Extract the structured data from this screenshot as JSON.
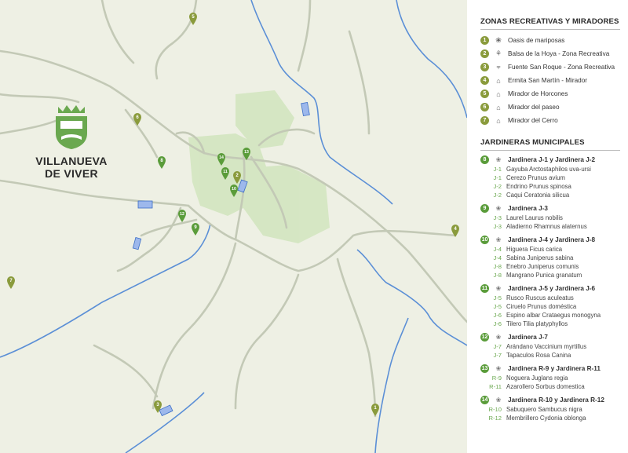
{
  "town": {
    "line1": "VILLANUEVA",
    "line2": "DE VIVER"
  },
  "colors": {
    "pin_olive": "#8a9b3c",
    "pin_green": "#5a9c3a",
    "road": "#bfc6b3",
    "river": "#5b8fd6",
    "park": "#cfe5b8",
    "feature_blue": "#9db8ec"
  },
  "legend": {
    "zones_title": "ZONAS RECREATIVAS Y MIRADORES",
    "zones": [
      {
        "num": "1",
        "icon": "butterfly-icon",
        "glyph": "❀",
        "label": "Oasis de mariposas"
      },
      {
        "num": "2",
        "icon": "tree-icon",
        "glyph": "⚘",
        "label": "Balsa de la Hoya - Zona Recreativa"
      },
      {
        "num": "3",
        "icon": "fountain-icon",
        "glyph": "⫧",
        "label": "Fuente San Roque - Zona Recreativa"
      },
      {
        "num": "4",
        "icon": "chapel-icon",
        "glyph": "⌂",
        "label": "Ermita San Martín - Mirador"
      },
      {
        "num": "5",
        "icon": "viewpoint-icon",
        "glyph": "⌂",
        "label": "Mirador de Horcones"
      },
      {
        "num": "6",
        "icon": "viewpoint-icon",
        "glyph": "⌂",
        "label": "Mirador del paseo"
      },
      {
        "num": "7",
        "icon": "viewpoint-icon",
        "glyph": "⌂",
        "label": "Mirador del Cerro"
      }
    ],
    "jard_title": "JARDINERAS MUNICIPALES",
    "jardineras": [
      {
        "num": "8",
        "title": "Jardinera J-1 y Jardinera J-2",
        "plants": [
          {
            "code": "J-1",
            "name": "Gayuba Arctostaphilos uva-ursi"
          },
          {
            "code": "J-1",
            "name": "Cerezo Prunus avium"
          },
          {
            "code": "J-2",
            "name": "Endrino Prunus spinosa"
          },
          {
            "code": "J-2",
            "name": "Caqui Ceratonia silicua"
          }
        ]
      },
      {
        "num": "9",
        "title": "Jardinera J-3",
        "plants": [
          {
            "code": "J-3",
            "name": "Laurel Laurus nobilis"
          },
          {
            "code": "J-3",
            "name": "Aladierno Rhamnus alaternus"
          }
        ]
      },
      {
        "num": "10",
        "title": "Jardinera J-4 y Jardinera J-8",
        "plants": [
          {
            "code": "J-4",
            "name": "Higuera Ficus carica"
          },
          {
            "code": "J-4",
            "name": "Sabina Juniperus sabina"
          },
          {
            "code": "J-8",
            "name": "Enebro Juniperus comunis"
          },
          {
            "code": "J-8",
            "name": "Mangrano Punica granatum"
          }
        ]
      },
      {
        "num": "11",
        "title": "Jardinera J-5 y Jardinera J-6",
        "plants": [
          {
            "code": "J-5",
            "name": "Rusco Ruscus aculeatus"
          },
          {
            "code": "J-5",
            "name": "Ciruelo Prunus doméstica"
          },
          {
            "code": "J-6",
            "name": "Espino albar Crataegus monogyna"
          },
          {
            "code": "J-6",
            "name": "Tilero Tilia platyphyllos"
          }
        ]
      },
      {
        "num": "12",
        "title": "Jardinera J-7",
        "plants": [
          {
            "code": "J-7",
            "name": "Arándano Vaccinium myrtillus"
          },
          {
            "code": "J-7",
            "name": "Tapaculos Rosa Canina"
          }
        ]
      },
      {
        "num": "13",
        "title": "Jardinera R-9 y Jardinera R-11",
        "plants": [
          {
            "code": "R-9",
            "name": "Noguera Juglans regia"
          },
          {
            "code": "R-11",
            "name": "Azarollero Sorbus domestica"
          }
        ]
      },
      {
        "num": "14",
        "title": "Jardinera R-10 y Jardinera R-12",
        "plants": [
          {
            "code": "R-10",
            "name": "Sabuquero Sambucus nigra"
          },
          {
            "code": "R-12",
            "name": "Membrillero Cydonia oblonga"
          }
        ]
      }
    ]
  },
  "map_pins": [
    {
      "label": "5",
      "color": "olive"
    },
    {
      "label": "6",
      "color": "olive"
    },
    {
      "label": "8",
      "color": "green"
    },
    {
      "label": "13",
      "color": "green"
    },
    {
      "label": "14",
      "color": "green"
    },
    {
      "label": "11",
      "color": "green"
    },
    {
      "label": "2",
      "color": "olive"
    },
    {
      "label": "10",
      "color": "green"
    },
    {
      "label": "12",
      "color": "green"
    },
    {
      "label": "9",
      "color": "green"
    },
    {
      "label": "4",
      "color": "olive"
    },
    {
      "label": "7",
      "color": "olive"
    },
    {
      "label": "3",
      "color": "olive"
    },
    {
      "label": "1",
      "color": "olive"
    }
  ]
}
